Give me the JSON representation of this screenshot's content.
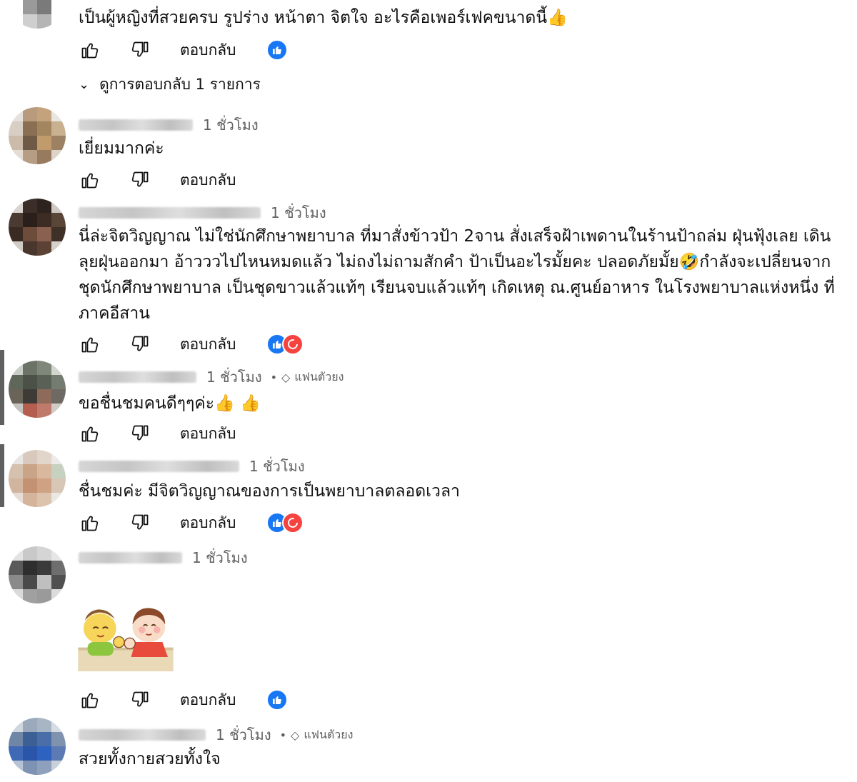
{
  "labels": {
    "reply": "ตอบกลับ",
    "view_replies": "ดูการตอบกลับ 1 รายการ",
    "fan_badge": "แฟนตัวยง"
  },
  "comments": [
    {
      "text": "เป็นผู้หญิงที่สวยครบ รูปร่าง หน้าตา จิตใจ อะไรคือเพอร์เฟคขนาดนี้👍",
      "reactions": [
        "like"
      ]
    },
    {
      "time": "1 ชั่วโมง",
      "text": "เยี่ยมมากค่ะ",
      "reactions": []
    },
    {
      "time": "1 ชั่วโมง",
      "text": "นี่ล่ะจิตวิญญาณ ไม่ใช่นักศึกษาพยาบาล ที่มาสั่งข้าวป้า 2จาน สั่งเสร็จฝ้าเพดานในร้านป้าถล่ม ฝุ่นฟุ้งเลย เดินลุยฝุ่นออกมา อ้าวววไปไหนหมดแล้ว ไม่ถงไม่ถามสักคำ ป้าเป็นอะไรมั้ยคะ ปลอดภัยมั้ย🤣กำลังจะเปลี่ยนจากชุดนักศึกษาพยาบาล เป็นชุดขาวแล้วแท้ๆ เรียนจบแล้วแท้ๆ เกิดเหตุ ณ.ศูนย์อาหาร ในโรงพยาบาลแห่งหนึ่ง ที่ภาคอีสาน",
      "reactions": [
        "like",
        "haha"
      ]
    },
    {
      "time": "1 ชั่วโมง",
      "fan": true,
      "text": "ขอชื่นชมคนดีๆๆค่ะ👍 👍",
      "reactions": []
    },
    {
      "time": "1 ชั่วโมง",
      "text": "ชื่นชมค่ะ มีจิตวิญญาณของการเป็นพยาบาลตลอดเวลา",
      "reactions": [
        "like",
        "haha"
      ]
    },
    {
      "time": "1 ชั่วโมง",
      "text": "",
      "sticker": "two-friends-sticker",
      "reactions": [
        "like"
      ]
    },
    {
      "time": "1 ชั่วโมง",
      "fan": true,
      "text": "สวยทั้งกายสวยทั้งใจ",
      "reactions": []
    }
  ],
  "icons": {
    "thumb_up": "thumb-up-icon",
    "thumb_down": "thumb-down-icon",
    "like_reaction": "like-reaction-icon",
    "haha_reaction": "haha-reaction-icon",
    "chevron": "chevron-down-icon",
    "diamond": "diamond-icon"
  },
  "colors": {
    "like_blue": "#1877f2",
    "haha_red": "#f5433f",
    "meta_gray": "#606060"
  }
}
